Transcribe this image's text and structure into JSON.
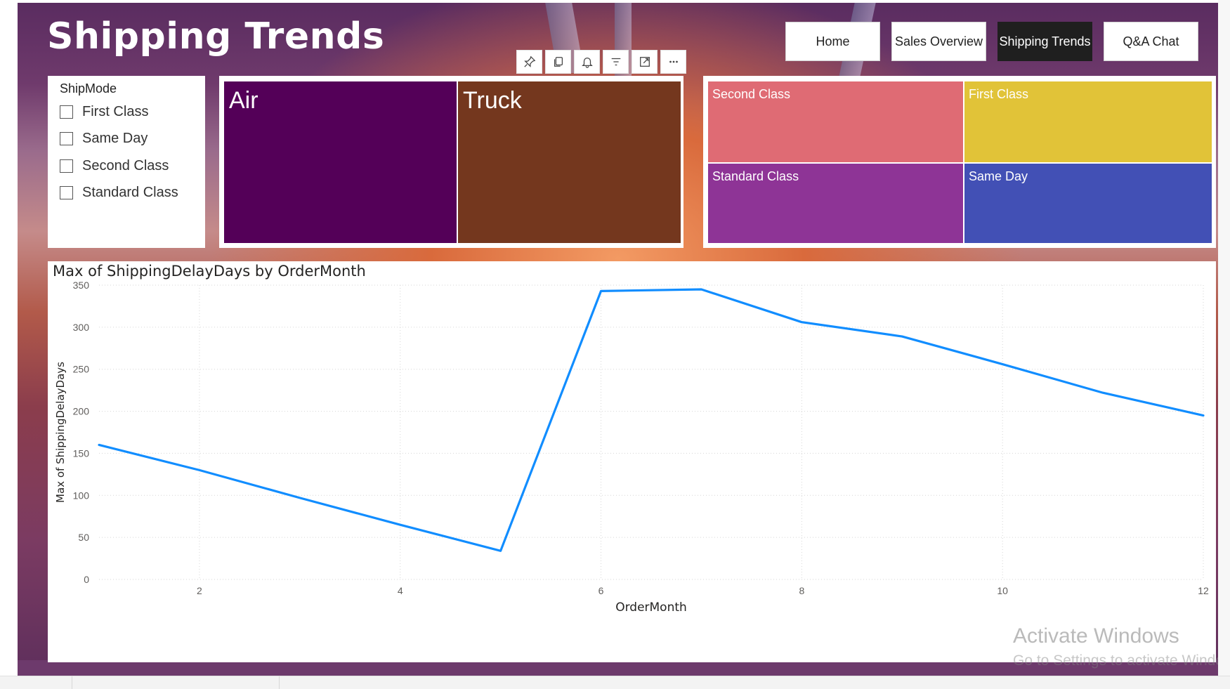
{
  "page": {
    "title": "Shipping Trends"
  },
  "nav": {
    "buttons": [
      {
        "label": "Home",
        "active": false
      },
      {
        "label": "Sales Overview",
        "active": false
      },
      {
        "label": "Shipping Trends",
        "active": true
      },
      {
        "label": "Q&A Chat",
        "active": false
      }
    ]
  },
  "visual_toolbar": {
    "icons": [
      "pin-icon",
      "copy-icon",
      "bell-icon",
      "filter-icon",
      "focus-mode-icon",
      "more-options-icon"
    ]
  },
  "slicer": {
    "title": "ShipMode",
    "items": [
      {
        "label": "First Class",
        "checked": false
      },
      {
        "label": "Same Day",
        "checked": false
      },
      {
        "label": "Second Class",
        "checked": false
      },
      {
        "label": "Standard Class",
        "checked": false
      }
    ]
  },
  "treemap_ship_by": {
    "tiles": [
      {
        "label": "Air",
        "color": "#540058"
      },
      {
        "label": "Truck",
        "color": "#74371e"
      }
    ]
  },
  "treemap_ship_mode": {
    "tiles": [
      {
        "label": "Second Class",
        "color": "#df6b74"
      },
      {
        "label": "First Class",
        "color": "#e1c338"
      },
      {
        "label": "Standard Class",
        "color": "#8e3496"
      },
      {
        "label": "Same Day",
        "color": "#4250b5"
      }
    ]
  },
  "chart_data": {
    "type": "line",
    "title": "Max of ShippingDelayDays by OrderMonth",
    "xlabel": "OrderMonth",
    "ylabel": "Max of ShippingDelayDays",
    "xlim": [
      1,
      12
    ],
    "ylim": [
      0,
      350
    ],
    "x_ticks": [
      2,
      4,
      6,
      8,
      10,
      12
    ],
    "y_ticks": [
      0,
      50,
      100,
      150,
      200,
      250,
      300,
      350
    ],
    "grid": true,
    "series": [
      {
        "color": "#118DFF",
        "x": [
          1,
          2,
          3,
          4,
          5,
          6,
          7,
          8,
          9,
          10,
          11,
          12
        ],
        "values": [
          160,
          130,
          97,
          65,
          34,
          343,
          345,
          306,
          289,
          256,
          222,
          195
        ]
      }
    ]
  },
  "watermark": {
    "line1": "Activate Windows",
    "line2": "Go to Settings to activate Windows."
  }
}
